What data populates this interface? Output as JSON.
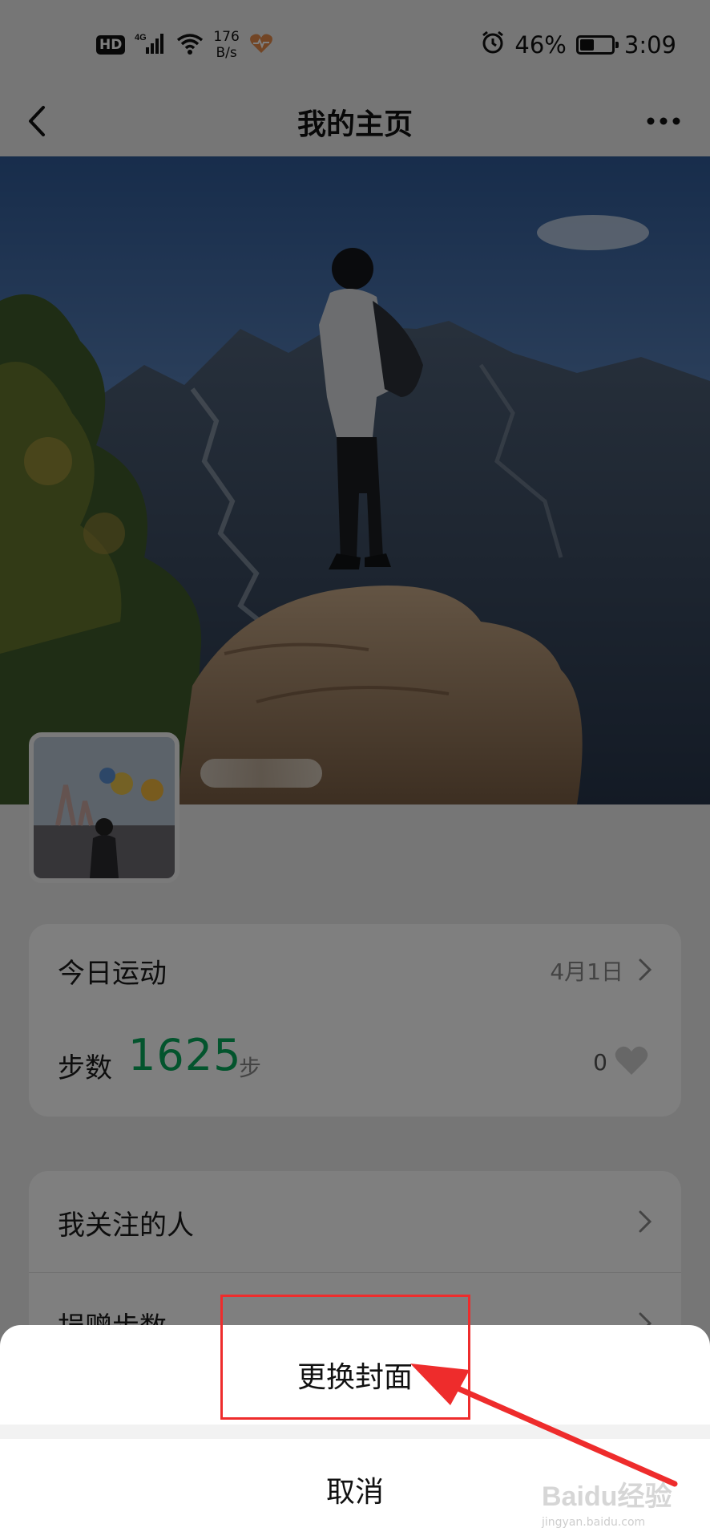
{
  "status_bar": {
    "hd": "HD",
    "network": "4G",
    "speed_value": "176",
    "speed_unit": "B/s",
    "battery": "46%",
    "time": "3:09"
  },
  "nav": {
    "title": "我的主页"
  },
  "today_card": {
    "title": "今日运动",
    "date": "4月1日",
    "steps_label": "步数",
    "steps_value": "1625",
    "steps_unit": "步",
    "likes": "0"
  },
  "menu": {
    "items": [
      {
        "label": "我关注的人"
      },
      {
        "label": "捐赠步数"
      }
    ]
  },
  "action_sheet": {
    "change_cover": "更换封面",
    "cancel": "取消"
  },
  "watermark": {
    "brand": "Baidu经验",
    "url": "jingyan.baidu.com"
  },
  "colors": {
    "accent_green": "#07a85b",
    "annotation_red": "#ee2c2c"
  }
}
